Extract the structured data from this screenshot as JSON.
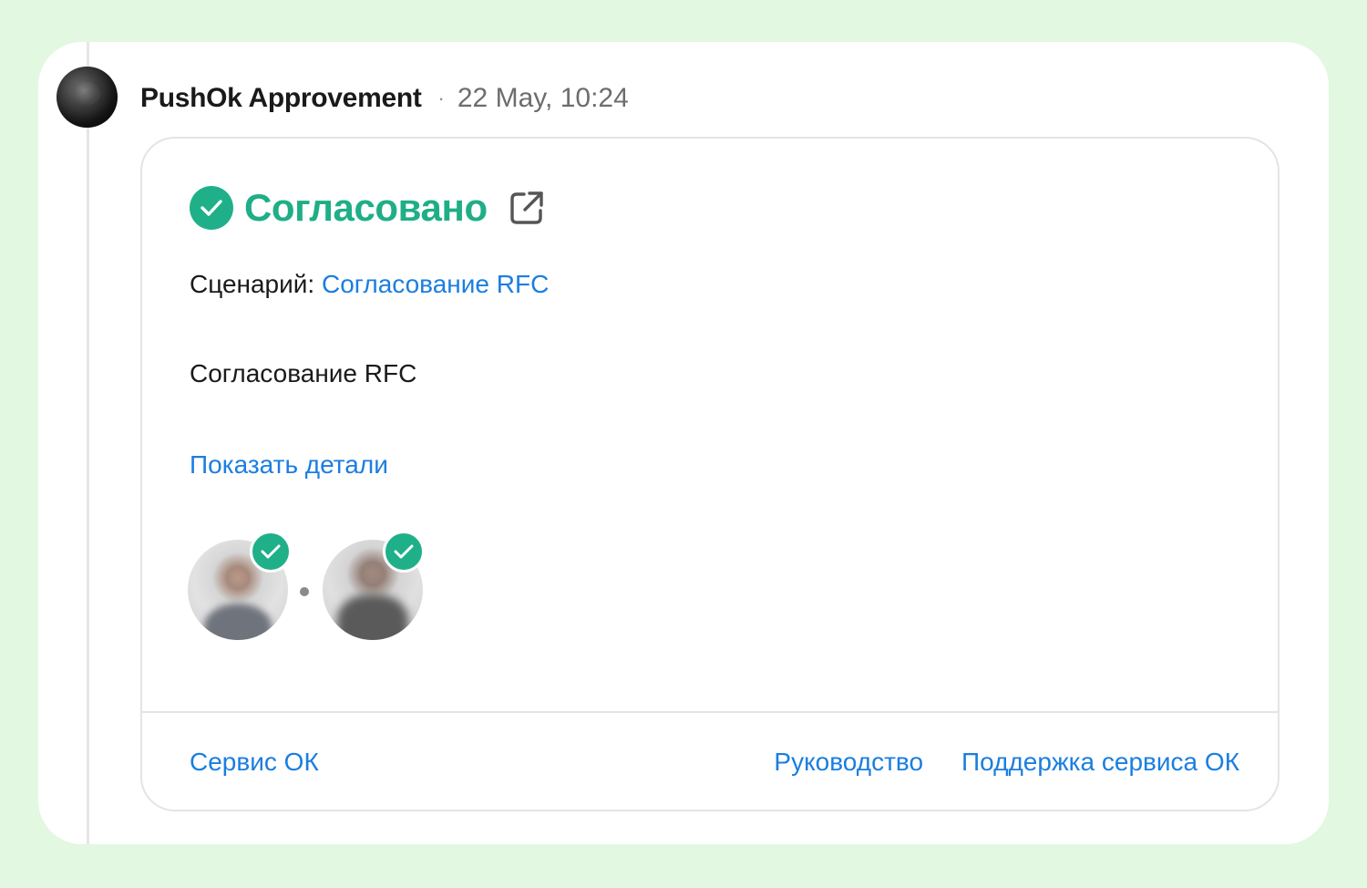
{
  "message": {
    "sender": "PushOk Approvement",
    "separator": "·",
    "timestamp": "22 May, 10:24"
  },
  "card": {
    "status": "Согласовано",
    "scenario_label": "Сценарий: ",
    "scenario_link": "Согласование RFC",
    "description": "Согласование RFC",
    "details_link": "Показать детали",
    "approvers": [
      {
        "status": "approved"
      },
      {
        "status": "approved"
      }
    ],
    "footer": {
      "left_link": "Сервис ОК",
      "right_links": [
        "Руководство",
        "Поддержка сервиса ОК"
      ]
    }
  },
  "colors": {
    "background": "#e2f8e1",
    "accent_green": "#1fb08a",
    "link_blue": "#1b7ee0"
  }
}
